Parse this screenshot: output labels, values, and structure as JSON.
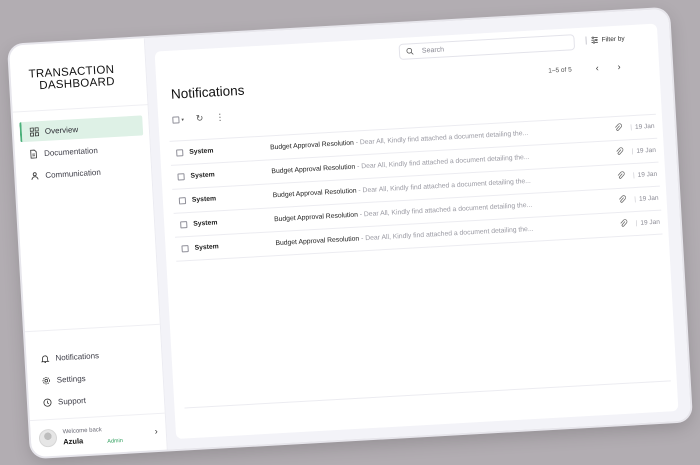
{
  "brand": {
    "line1": "TRANSACTION",
    "line2": "DASHBOARD"
  },
  "sidebar": {
    "items": [
      {
        "label": "Overview",
        "icon": "grid-icon",
        "active": true
      },
      {
        "label": "Documentation",
        "icon": "document-icon",
        "active": false
      },
      {
        "label": "Communication",
        "icon": "people-icon",
        "active": false
      }
    ],
    "bottom_items": [
      {
        "label": "Notifications",
        "icon": "bell-icon"
      },
      {
        "label": "Settings",
        "icon": "gear-icon"
      },
      {
        "label": "Support",
        "icon": "help-circle-icon"
      }
    ],
    "user": {
      "welcome": "Welcome back",
      "name": "Azula",
      "role": "Admin"
    }
  },
  "header": {
    "search_placeholder": "Search",
    "filter_label": "Filter by"
  },
  "main": {
    "title": "Notifications",
    "pagination": "1–5 of 5",
    "rows": [
      {
        "sender": "System",
        "subject": "Budget Approval Resolution",
        "preview": " - Dear All, Kindly find attached a document detailing the...",
        "date": "19 Jan"
      },
      {
        "sender": "System",
        "subject": "Budget Approval Resolution",
        "preview": " - Dear All, Kindly find attached a document detailing the...",
        "date": "19 Jan"
      },
      {
        "sender": "System",
        "subject": "Budget Approval Resolution",
        "preview": " - Dear All, Kindly find attached a document detailing the...",
        "date": "19 Jan"
      },
      {
        "sender": "System",
        "subject": "Budget Approval Resolution",
        "preview": " - Dear All, Kindly find attached a document detailing the...",
        "date": "19 Jan"
      },
      {
        "sender": "System",
        "subject": "Budget Approval Resolution",
        "preview": " - Dear All, Kindly find attached a document detailing the...",
        "date": "19 Jan"
      }
    ]
  },
  "colors": {
    "accent": "#4bb07a",
    "active_bg": "#def1e6",
    "background": "#b2adb2"
  }
}
